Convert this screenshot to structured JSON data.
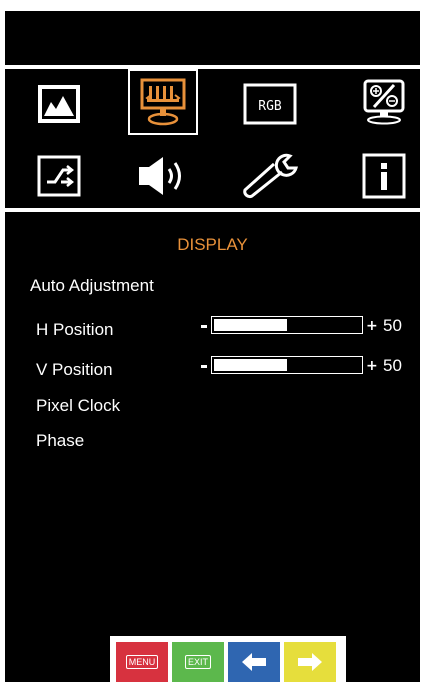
{
  "header": {
    "title": "DISPLAY"
  },
  "icons": [
    {
      "name": "picture-icon"
    },
    {
      "name": "display-icon",
      "selected": true
    },
    {
      "name": "rgb-icon",
      "label": "RGB"
    },
    {
      "name": "color-adjust-icon"
    },
    {
      "name": "input-source-icon"
    },
    {
      "name": "audio-icon"
    },
    {
      "name": "settings-wrench-icon"
    },
    {
      "name": "info-icon"
    }
  ],
  "menu": {
    "auto_adjustment": "Auto Adjustment",
    "h_position": {
      "label": "H Position",
      "value": "50",
      "level": 0.5
    },
    "v_position": {
      "label": "V Position",
      "value": "50",
      "level": 0.5
    },
    "pixel_clock": "Pixel Clock",
    "phase": "Phase"
  },
  "buttons": {
    "menu": "MENU",
    "exit": "EXIT"
  },
  "colors": {
    "accent": "#e8913a",
    "menu_btn": "#d7323f",
    "exit_btn": "#5cb84c",
    "left_btn": "#2f66b1",
    "right_btn": "#e6de3c"
  }
}
